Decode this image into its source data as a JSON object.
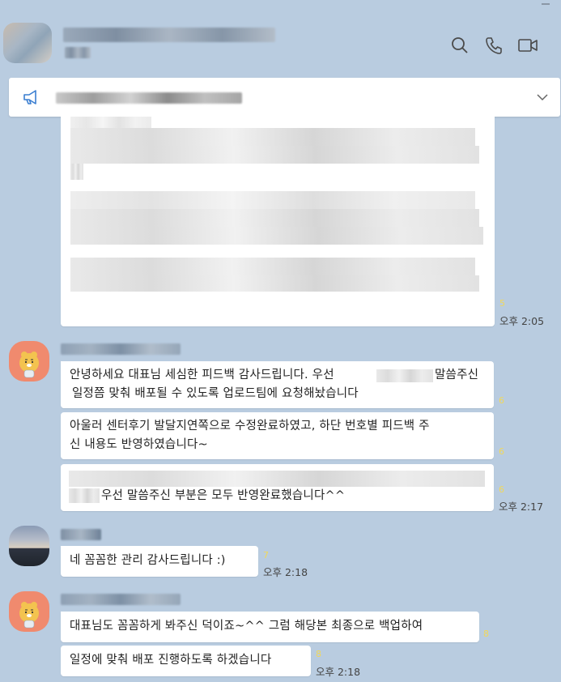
{
  "header": {
    "title": "",
    "icons": [
      "search-icon",
      "phone-icon",
      "video-icon"
    ]
  },
  "notice": {
    "text": "",
    "icon": "megaphone-icon",
    "toggle": "chevron-down-icon"
  },
  "messages": [
    {
      "id": "m0",
      "sender": "other",
      "text": "",
      "unread": "5",
      "time": "오후 2:05"
    },
    {
      "id": "m1",
      "sender": "ryan",
      "text": "안녕하세요 대표님 세심한 피드백 감사드립니다. 우선",
      "text_b": "말씀주신",
      "text2": "일정쯤 맞춰 배포될 수 있도록 업로드팀에 요청해놨습니다",
      "unread": "6"
    },
    {
      "id": "m2",
      "sender": "ryan",
      "text": "아울러 센터후기 발달지연쪽으로 수정완료하였고, 하단 번호별 피드백 주",
      "text2": "신 내용도 반영하였습니다~",
      "unread": "6"
    },
    {
      "id": "m3",
      "sender": "ryan",
      "text": "우선 말씀주신 부분은 모두 반영완료했습니다^^",
      "unread": "6",
      "time": "오후 2:17"
    },
    {
      "id": "m4",
      "sender": "boss",
      "text": "네 꼼꼼한 관리 감사드립니다 :)",
      "unread": "7",
      "time": "오후 2:18"
    },
    {
      "id": "m5",
      "sender": "ryan",
      "text": "대표님도 꼼꼼하게 봐주신 덕이죠~^^ 그럼 해당본 최종으로 백업하여",
      "unread": "8"
    },
    {
      "id": "m6",
      "sender": "ryan",
      "text": "일정에 맞춰 배포 진행하도록 하겠습니다",
      "unread": "8",
      "time": "오후 2:18"
    }
  ]
}
